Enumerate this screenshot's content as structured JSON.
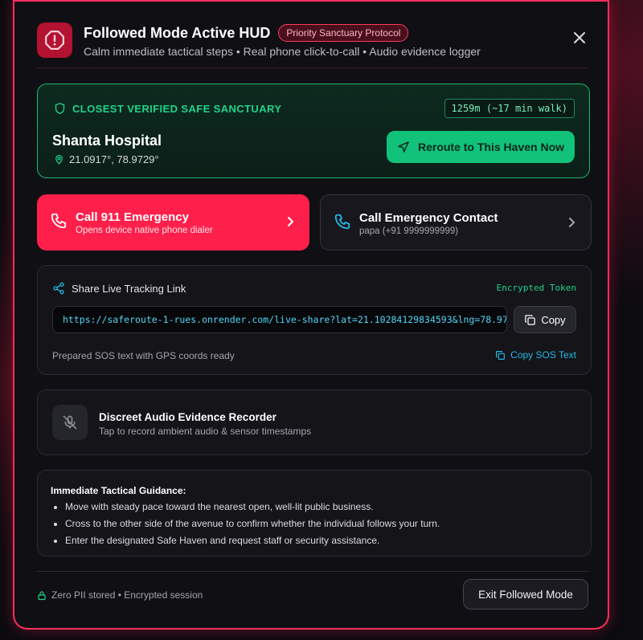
{
  "header": {
    "title": "Followed Mode Active HUD",
    "badge": "Priority Sanctuary Protocol",
    "subtitle": "Calm immediate tactical steps • Real phone click-to-call • Audio evidence logger"
  },
  "sanctuary": {
    "label": "CLOSEST VERIFIED SAFE SANCTUARY",
    "distance": "1259m (~17 min walk)",
    "name": "Shanta Hospital",
    "coords": "21.0917°, 78.9729°",
    "reroute_label": "Reroute to This Haven Now"
  },
  "calls": {
    "emergency": {
      "title": "Call 911 Emergency",
      "subtitle": "Opens device native phone dialer"
    },
    "contact": {
      "title": "Call Emergency Contact",
      "subtitle": "papa (+91 9999999999)"
    }
  },
  "share": {
    "title": "Share Live Tracking Link",
    "token": "Encrypted Token",
    "link": "https://saferoute-1-rues.onrender.com/live-share?lat=21.10284129834593&lng=78.97",
    "copy_label": "Copy",
    "prepared_text": "Prepared SOS text with GPS coords ready",
    "copy_sos_label": "Copy SOS Text"
  },
  "recorder": {
    "title": "Discreet Audio Evidence Recorder",
    "subtitle": "Tap to record ambient audio & sensor timestamps"
  },
  "guidance": {
    "title": "Immediate Tactical Guidance:",
    "items": [
      "Move with steady pace toward the nearest open, well-lit public business.",
      "Cross to the other side of the avenue to confirm whether the individual follows your turn.",
      "Enter the designated Safe Haven and request staff or security assistance."
    ]
  },
  "footer": {
    "privacy": "Zero PII stored • Encrypted session",
    "exit_label": "Exit Followed Mode"
  },
  "colors": {
    "accent_red": "#ff1f4b",
    "accent_green": "#12c27a",
    "link_cyan": "#4fd6f5"
  }
}
